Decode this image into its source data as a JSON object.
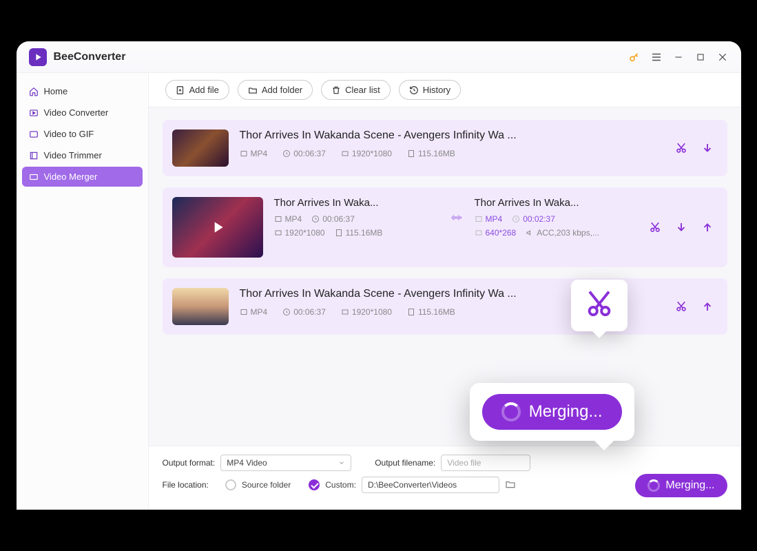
{
  "app": {
    "title": "BeeConverter"
  },
  "sidebar": {
    "items": [
      {
        "label": "Home"
      },
      {
        "label": "Video Converter"
      },
      {
        "label": "Video to GIF"
      },
      {
        "label": "Video Trimmer"
      },
      {
        "label": "Video Merger"
      }
    ]
  },
  "toolbar": {
    "add_file": "Add file",
    "add_folder": "Add folder",
    "clear_list": "Clear list",
    "history": "History"
  },
  "files": [
    {
      "title": "Thor Arrives In Wakanda Scene - Avengers Infinity Wa ...",
      "format": "MP4",
      "duration": "00:06:37",
      "resolution": "1920*1080",
      "size": "115.16MB"
    },
    {
      "title_src": "Thor Arrives In Waka...",
      "src": {
        "format": "MP4",
        "duration": "00:06:37",
        "resolution": "1920*1080",
        "size": "115.16MB"
      },
      "title_dst": "Thor Arrives In Waka...",
      "dst": {
        "format": "MP4",
        "duration": "00:02:37",
        "resolution": "640*268",
        "audio": "ACC,203 kbps,..."
      }
    },
    {
      "title": "Thor Arrives In Wakanda Scene - Avengers Infinity Wa ...",
      "format": "MP4",
      "duration": "00:06:37",
      "resolution": "1920*1080",
      "size": "115.16MB"
    }
  ],
  "output": {
    "format_label": "Output format:",
    "format_value": "MP4 Video",
    "filename_label": "Output filename:",
    "filename_placeholder": "Video file",
    "location_label": "File location:",
    "source_folder": "Source folder",
    "custom": "Custom:",
    "path": "D:\\BeeConverter\\Videos"
  },
  "status": {
    "merging": "Merging..."
  }
}
